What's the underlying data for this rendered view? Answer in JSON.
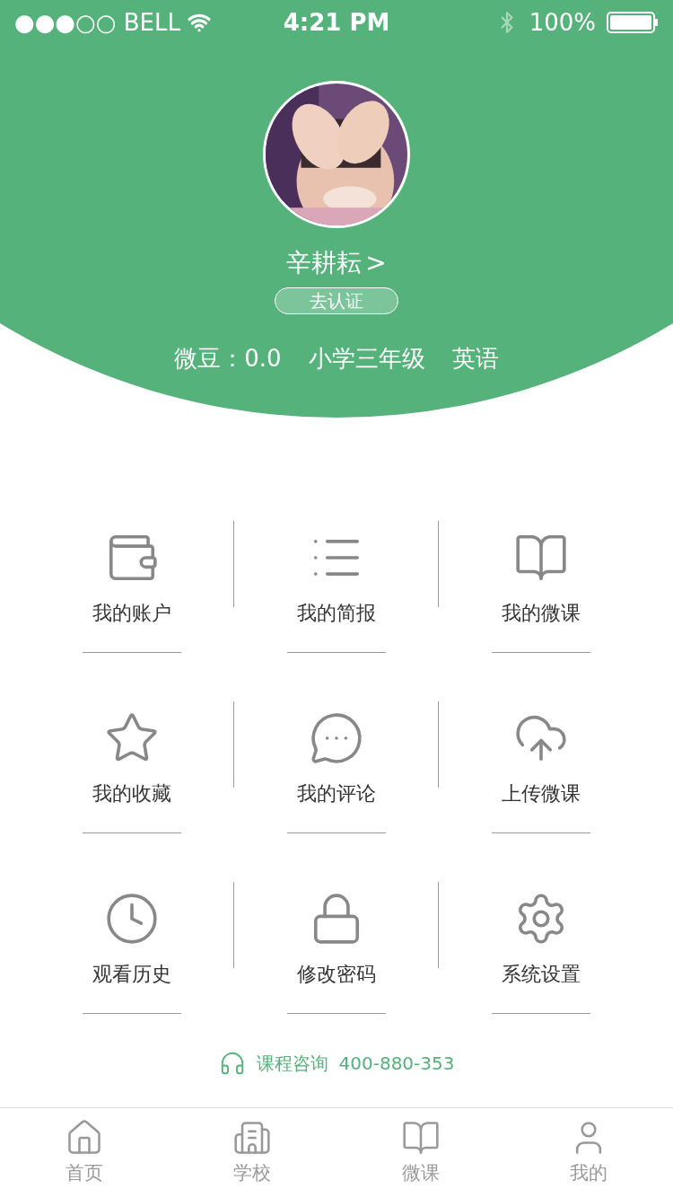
{
  "status_bar": {
    "carrier": "●●●○○ BELL",
    "time": "4:21 PM",
    "battery": "100%"
  },
  "profile": {
    "name": "辛耕耘",
    "name_arrow": ">",
    "verify_button": "去认证",
    "stats": [
      "微豆：0.0",
      "小学三年级",
      "英语"
    ]
  },
  "menu": [
    {
      "kind": "wallet",
      "label": "我的账户"
    },
    {
      "kind": "list",
      "label": "我的简报"
    },
    {
      "kind": "book",
      "label": "我的微课"
    },
    {
      "kind": "star",
      "label": "我的收藏"
    },
    {
      "kind": "chat",
      "label": "我的评论"
    },
    {
      "kind": "upload",
      "label": "上传微课"
    },
    {
      "kind": "clock",
      "label": "观看历史"
    },
    {
      "kind": "lock",
      "label": "修改密码"
    },
    {
      "kind": "gear",
      "label": "系统设置"
    }
  ],
  "consult": {
    "label": "课程咨询",
    "phone": "400-880-353"
  },
  "tab_bar": [
    {
      "kind": "home",
      "label": "首页"
    },
    {
      "kind": "school",
      "label": "学校"
    },
    {
      "kind": "book",
      "label": "微课"
    },
    {
      "kind": "user",
      "label": "我的"
    }
  ]
}
